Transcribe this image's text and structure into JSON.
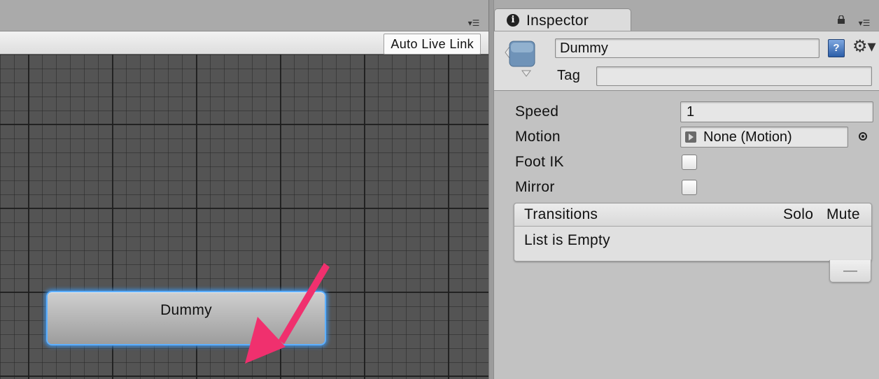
{
  "graph": {
    "toolbar": {
      "auto_live_link_label": "Auto Live Link"
    },
    "panel_menu_glyph": "▾☰",
    "state_node": {
      "label": "Dummy"
    },
    "annotation_arrow_color": "#f0306e",
    "selection_color": "#4a9fff"
  },
  "inspector": {
    "tab": {
      "icon": "info-icon",
      "label": "Inspector"
    },
    "panel_menu_glyph": "▾☰",
    "header": {
      "name_value": "Dummy",
      "tag_label": "Tag",
      "tag_value": "",
      "help_glyph": "?",
      "gear_glyph": "⚙▾"
    },
    "properties": {
      "speed_label": "Speed",
      "speed_value": "1",
      "motion_label": "Motion",
      "motion_value": "None (Motion)",
      "foot_ik_label": "Foot IK",
      "foot_ik_checked": false,
      "mirror_label": "Mirror",
      "mirror_checked": false
    },
    "transitions": {
      "title": "Transitions",
      "columns": [
        "Solo",
        "Mute"
      ],
      "empty_text": "List is Empty",
      "remove_glyph": "—"
    }
  }
}
